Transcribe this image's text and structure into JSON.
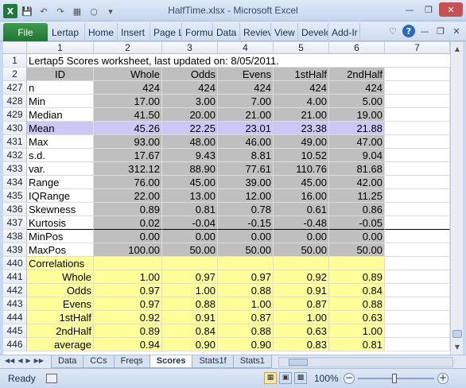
{
  "window": {
    "title": "HalfTime.xlsx  -  Microsoft Excel"
  },
  "ribbon": {
    "file_label": "File",
    "tabs": [
      "Lertap",
      "Home",
      "Insert",
      "Page L",
      "Formu",
      "Data",
      "Reviev",
      "View",
      "Develc",
      "Add-Ir"
    ]
  },
  "columns": [
    "1",
    "2",
    "3",
    "4",
    "5",
    "6",
    "7"
  ],
  "title_row": {
    "rownum": "1",
    "text": "Lertap5 Scores worksheet, last updated on: 8/05/2011."
  },
  "header_row": {
    "rownum": "2",
    "cells": [
      "ID",
      "Whole",
      "Odds",
      "Evens",
      "1stHalf",
      "2ndHalf"
    ]
  },
  "stats_rows": [
    {
      "rownum": "427",
      "label": "n",
      "values": [
        "424",
        "424",
        "424",
        "424",
        "424"
      ]
    },
    {
      "rownum": "428",
      "label": "Min",
      "values": [
        "17.00",
        "3.00",
        "7.00",
        "4.00",
        "5.00"
      ]
    },
    {
      "rownum": "429",
      "label": "Median",
      "values": [
        "41.50",
        "20.00",
        "21.00",
        "21.00",
        "19.00"
      ]
    },
    {
      "rownum": "430",
      "label": "Mean",
      "values": [
        "45.26",
        "22.25",
        "23.01",
        "23.38",
        "21.88"
      ]
    },
    {
      "rownum": "431",
      "label": "Max",
      "values": [
        "93.00",
        "48.00",
        "46.00",
        "49.00",
        "47.00"
      ]
    },
    {
      "rownum": "432",
      "label": "s.d.",
      "values": [
        "17.67",
        "9.43",
        "8.81",
        "10.52",
        "9.04"
      ]
    },
    {
      "rownum": "433",
      "label": "var.",
      "values": [
        "312.12",
        "88.90",
        "77.61",
        "110.76",
        "81.68"
      ]
    },
    {
      "rownum": "434",
      "label": "Range",
      "values": [
        "76.00",
        "45.00",
        "39.00",
        "45.00",
        "42.00"
      ]
    },
    {
      "rownum": "435",
      "label": "IQRange",
      "values": [
        "22.00",
        "13.00",
        "12.00",
        "16.00",
        "11.25"
      ]
    },
    {
      "rownum": "436",
      "label": "Skewness",
      "values": [
        "0.89",
        "0.81",
        "0.78",
        "0.61",
        "0.86"
      ]
    },
    {
      "rownum": "437",
      "label": "Kurtosis",
      "values": [
        "0.02",
        "-0.04",
        "-0.15",
        "-0.48",
        "-0.05"
      ]
    },
    {
      "rownum": "438",
      "label": "MinPos",
      "values": [
        "0.00",
        "0.00",
        "0.00",
        "0.00",
        "0.00"
      ]
    },
    {
      "rownum": "439",
      "label": "MaxPos",
      "values": [
        "100.00",
        "50.00",
        "50.00",
        "50.00",
        "50.00"
      ]
    }
  ],
  "correlations": {
    "rownum": "440",
    "title": "Correlations",
    "rows": [
      {
        "rownum": "441",
        "label": "Whole",
        "values": [
          "1.00",
          "0.97",
          "0.97",
          "0.92",
          "0.89"
        ]
      },
      {
        "rownum": "442",
        "label": "Odds",
        "values": [
          "0.97",
          "1.00",
          "0.88",
          "0.91",
          "0.84"
        ]
      },
      {
        "rownum": "443",
        "label": "Evens",
        "values": [
          "0.97",
          "0.88",
          "1.00",
          "0.87",
          "0.88"
        ]
      },
      {
        "rownum": "444",
        "label": "1stHalf",
        "values": [
          "0.92",
          "0.91",
          "0.87",
          "1.00",
          "0.63"
        ]
      },
      {
        "rownum": "445",
        "label": "2ndHalf",
        "values": [
          "0.89",
          "0.84",
          "0.88",
          "0.63",
          "1.00"
        ]
      },
      {
        "rownum": "446",
        "label": "average",
        "values": [
          "0.94",
          "0.90",
          "0.90",
          "0.83",
          "0.81"
        ]
      }
    ]
  },
  "sheet_tabs": [
    "Data",
    "CCs",
    "Freqs",
    "Scores",
    "Stats1f",
    "Stats1"
  ],
  "active_sheet": "Scores",
  "status": {
    "ready": "Ready",
    "zoom": "100%"
  },
  "colors": {
    "header_gray": "#bfbfbf",
    "mean_highlight": "#c9c9f5",
    "correlation_yellow": "#ffff99",
    "file_tab_green": "#1f7634"
  }
}
